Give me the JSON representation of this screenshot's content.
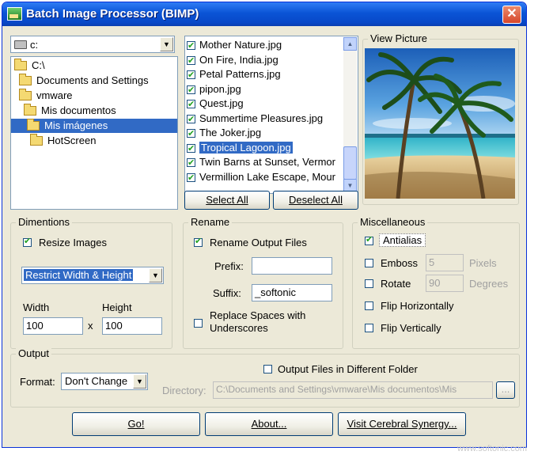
{
  "window": {
    "title": "Batch Image Processor (BIMP)",
    "close_glyph": "✕"
  },
  "drive": {
    "label": "c:",
    "arrow": "▼"
  },
  "tree": {
    "items": [
      {
        "label": "C:\\",
        "indent": 0,
        "selected": false
      },
      {
        "label": "Documents and Settings",
        "indent": 1,
        "selected": false
      },
      {
        "label": "vmware",
        "indent": 2,
        "selected": false
      },
      {
        "label": "Mis documentos",
        "indent": 3,
        "selected": false
      },
      {
        "label": "Mis imágenes",
        "indent": 4,
        "selected": true
      },
      {
        "label": "HotScreen",
        "indent": 5,
        "selected": false
      }
    ]
  },
  "files": {
    "items": [
      {
        "name": "Mother Nature.jpg",
        "checked": true,
        "selected": false
      },
      {
        "name": "On Fire, India.jpg",
        "checked": true,
        "selected": false
      },
      {
        "name": "Petal Patterns.jpg",
        "checked": true,
        "selected": false
      },
      {
        "name": "pipon.jpg",
        "checked": true,
        "selected": false
      },
      {
        "name": "Quest.jpg",
        "checked": true,
        "selected": false
      },
      {
        "name": "Summertime Pleasures.jpg",
        "checked": true,
        "selected": false
      },
      {
        "name": "The Joker.jpg",
        "checked": true,
        "selected": false
      },
      {
        "name": "Tropical Lagoon.jpg",
        "checked": true,
        "selected": true
      },
      {
        "name": "Twin Barns at Sunset, Vermor",
        "checked": true,
        "selected": false
      },
      {
        "name": "Vermillion Lake Escape, Mour",
        "checked": true,
        "selected": false
      }
    ],
    "scroll_up": "▲",
    "scroll_down": "▼"
  },
  "buttons": {
    "select_all": "Select All",
    "deselect_all": "Deselect All",
    "go": "Go!",
    "about": "About...",
    "visit": "Visit Cerebral Synergy...",
    "browse": "..."
  },
  "view_picture": {
    "label": "View Picture"
  },
  "dimensions": {
    "label": "Dimentions",
    "resize_label": "Resize Images",
    "resize_checked": true,
    "mode": "Restrict Width & Height",
    "width_label": "Width",
    "height_label": "Height",
    "width_value": "100",
    "height_value": "100",
    "times": "x"
  },
  "rename": {
    "label": "Rename",
    "rename_output_label": "Rename Output Files",
    "rename_output_checked": true,
    "prefix_label": "Prefix:",
    "prefix_value": "",
    "suffix_label": "Suffix:",
    "suffix_value": "_softonic",
    "replace_spaces_label_1": "Replace Spaces with",
    "replace_spaces_label_2": "Underscores",
    "replace_spaces_checked": false
  },
  "misc": {
    "label": "Miscellaneous",
    "antialias": "Antialias",
    "antialias_checked": true,
    "emboss": "Emboss",
    "emboss_value": "5",
    "emboss_unit": "Pixels",
    "rotate": "Rotate",
    "rotate_value": "90",
    "rotate_unit": "Degrees",
    "flip_h": "Flip Horizontally",
    "flip_v": "Flip Vertically"
  },
  "output": {
    "label": "Output",
    "format_label": "Format:",
    "format_value": "Don't Change",
    "different_folder_label": "Output Files in Different Folder",
    "different_folder_checked": false,
    "directory_label": "Directory:",
    "directory_value": "C:\\Documents and Settings\\vmware\\Mis documentos\\Mis"
  },
  "status": {
    "watermark": "www.softonic.com"
  }
}
